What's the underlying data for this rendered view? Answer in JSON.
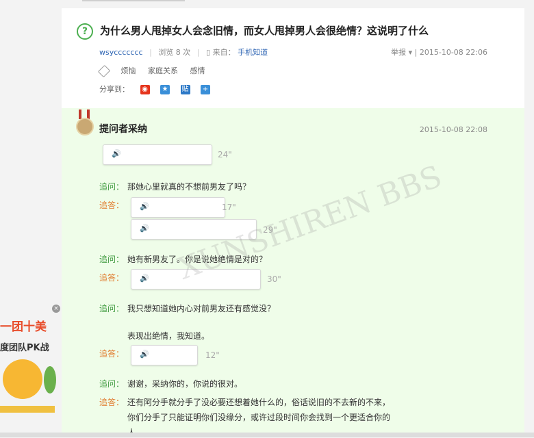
{
  "question": {
    "title": "为什么男人甩掉女人会念旧情，而女人甩掉男人会很绝情？这说明了什么",
    "user": "wsyccccccc",
    "views": "浏览 8 次",
    "source_prefix": "来自：",
    "source": "手机知道",
    "report": "举报",
    "time": "2015-10-08 22:06",
    "tags": [
      "烦恼",
      "家庭关系",
      "感情"
    ],
    "share_label": "分享到："
  },
  "answer": {
    "header": "提问者采纳",
    "time": "2015-10-08 22:08",
    "voice_glyph": "🔊",
    "ask_label": "追问：",
    "ans_label": "追答：",
    "durations": [
      "24\"",
      "17\"",
      "29\"",
      "30\"",
      "12\""
    ],
    "q1": "那她心里就真的不想前男友了吗？",
    "q2": "她有新男友了。你是说她绝情是对的？",
    "q3": "我只想知道她内心对前男友还有感觉没？",
    "q3b": "表现出绝情，我知道。",
    "q4": "谢谢，采纳你的，你说的很对。",
    "a_text1": "还有阿分手就分手了没必要还想着她什么的，俗话说旧的不去新的不来，",
    "a_text2": "你们分手了只能证明你们没缘分，或许过段时间你会找到一个更适合你的",
    "a_text3": "人"
  },
  "ad": {
    "close": "×",
    "title": "一团十美",
    "sub": "度团队PK战"
  },
  "watermark": "XUNSHIREN BBS"
}
